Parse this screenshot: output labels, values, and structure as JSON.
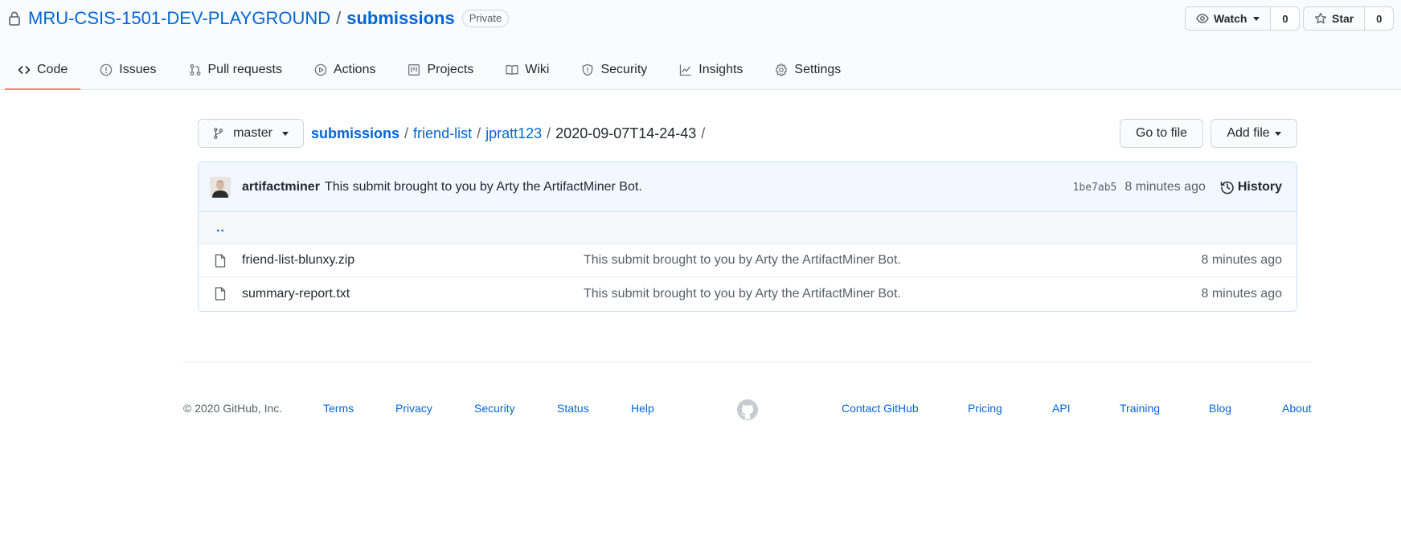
{
  "header": {
    "owner": "MRU-CSIS-1501-DEV-PLAYGROUND",
    "separator": "/",
    "repo": "submissions",
    "visibility": "Private",
    "watch_label": "Watch",
    "watch_count": "0",
    "star_label": "Star",
    "star_count": "0"
  },
  "tabs": [
    {
      "label": "Code",
      "icon": "code-icon",
      "active": true
    },
    {
      "label": "Issues",
      "icon": "issue-icon"
    },
    {
      "label": "Pull requests",
      "icon": "pull-request-icon"
    },
    {
      "label": "Actions",
      "icon": "play-icon"
    },
    {
      "label": "Projects",
      "icon": "project-icon"
    },
    {
      "label": "Wiki",
      "icon": "book-icon"
    },
    {
      "label": "Security",
      "icon": "shield-icon"
    },
    {
      "label": "Insights",
      "icon": "graph-icon"
    },
    {
      "label": "Settings",
      "icon": "gear-icon"
    }
  ],
  "nav": {
    "branch": "master",
    "breadcrumb": [
      "submissions",
      "friend-list",
      "jpratt123",
      "2020-09-07T14-24-43"
    ],
    "separator": "/",
    "go_to_file": "Go to file",
    "add_file": "Add file"
  },
  "commit": {
    "author": "artifactminer",
    "message": "This submit brought to you by Arty the ArtifactMiner Bot.",
    "sha": "1be7ab5",
    "time": "8 minutes ago",
    "history_label": "History"
  },
  "files": {
    "parent": "..",
    "rows": [
      {
        "name": "friend-list-blunxy.zip",
        "message": "This submit brought to you by Arty the ArtifactMiner Bot.",
        "age": "8 minutes ago"
      },
      {
        "name": "summary-report.txt",
        "message": "This submit brought to you by Arty the ArtifactMiner Bot.",
        "age": "8 minutes ago"
      }
    ]
  },
  "footer": {
    "copyright": "© 2020 GitHub, Inc.",
    "links_left": [
      "Terms",
      "Privacy",
      "Security",
      "Status",
      "Help"
    ],
    "links_right": [
      "Contact GitHub",
      "Pricing",
      "API",
      "Training",
      "Blog",
      "About"
    ],
    "logo_icon": "github-mark-icon"
  },
  "colors": {
    "link": "#0366d6",
    "active_tab_border": "#f9826c",
    "commit_bar_bg": "#f1f8ff"
  }
}
